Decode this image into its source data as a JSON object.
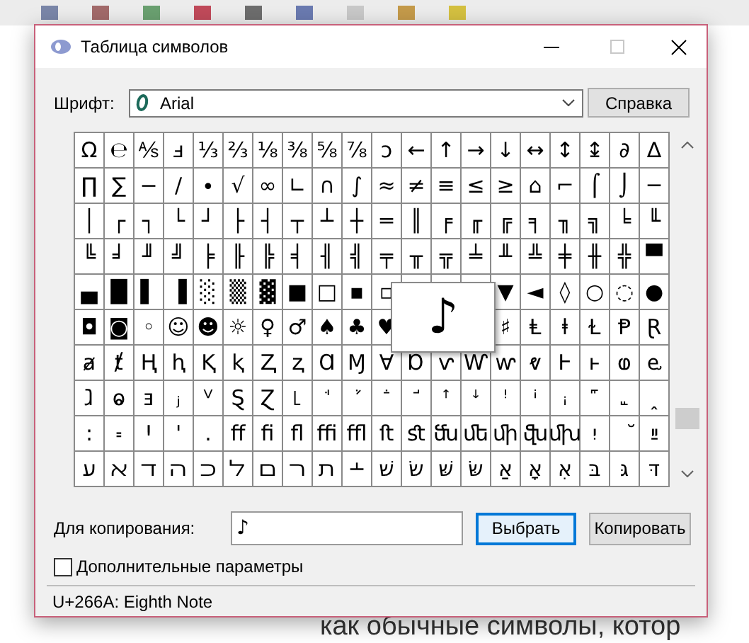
{
  "window": {
    "title": "Таблица символов"
  },
  "font": {
    "label": "Шрифт:",
    "value": "Arial"
  },
  "help_button": "Справка",
  "grid": {
    "rows": [
      [
        "Ω",
        "℮",
        "⅍",
        "ⅎ",
        "⅓",
        "⅔",
        "⅛",
        "⅜",
        "⅝",
        "⅞",
        "ↄ",
        "←",
        "↑",
        "→",
        "↓",
        "↔",
        "↕",
        "↨",
        "∂",
        "∆"
      ],
      [
        "∏",
        "∑",
        "−",
        "∕",
        "∙",
        "√",
        "∞",
        "∟",
        "∩",
        "∫",
        "≈",
        "≠",
        "≡",
        "≤",
        "≥",
        "⌂",
        "⌐",
        "⌠",
        "⌡",
        "─"
      ],
      [
        "│",
        "┌",
        "┐",
        "└",
        "┘",
        "├",
        "┤",
        "┬",
        "┴",
        "┼",
        "═",
        "║",
        "╒",
        "╓",
        "╔",
        "╕",
        "╖",
        "╗",
        "╘",
        "╙"
      ],
      [
        "╚",
        "╛",
        "╜",
        "╝",
        "╞",
        "╟",
        "╠",
        "╡",
        "╢",
        "╣",
        "╤",
        "╥",
        "╦",
        "╧",
        "╨",
        "╩",
        "╪",
        "╫",
        "╬",
        "▀"
      ],
      [
        "▄",
        "█",
        "▌",
        "▐",
        "░",
        "▒",
        "▓",
        "■",
        "□",
        "▪",
        "▫",
        null,
        null,
        null,
        "▼",
        "◄",
        "◊",
        "○",
        "◌",
        "●"
      ],
      [
        "◘",
        "◙",
        "◦",
        "☺",
        "☻",
        "☼",
        "♀",
        "♂",
        "♠",
        "♣",
        "♥",
        null,
        null,
        null,
        "♯",
        "Ⱡ",
        "ⱡ",
        "Ɫ",
        "Ᵽ",
        "Ɽ"
      ],
      [
        "ⱥ",
        "ⱦ",
        "Ⱨ",
        "ⱨ",
        "Ⱪ",
        "ⱪ",
        "Ⱬ",
        "ⱬ",
        "Ɑ",
        "Ɱ",
        "Ɐ",
        "Ɒ",
        "ⱱ",
        "Ⱳ",
        "ⱳ",
        "ⱴ",
        "Ⱶ",
        "ⱶ",
        "ⱷ",
        "ⱸ"
      ],
      [
        "ⱹ",
        "ⱺ",
        "ⱻ",
        "ⱼ",
        "ⱽ",
        "Ȿ",
        "Ɀ",
        "꜖",
        "ꜗ",
        "ꜘ",
        "ꜙ",
        "ꜚ",
        "ꜛ",
        "ꜜ",
        "ꜝ",
        "ꜞ",
        "ꜟ",
        "꜠",
        "꜡",
        "ꞈ"
      ],
      [
        "꞉",
        "꞊",
        "Ꞌ",
        "ꞌ",
        ".",
        "ﬀ",
        "ﬁ",
        "ﬂ",
        "ﬃ",
        "ﬄ",
        "ﬅ",
        "ﬆ",
        "ﬓ",
        "ﬔ",
        "ﬕ",
        "ﬖ",
        "ﬗ",
        "יִ",
        "ﬞ",
        "ײַ"
      ],
      [
        "ﬠ",
        "ﬡ",
        "ﬢ",
        "ﬣ",
        "ﬤ",
        "ﬥ",
        "ﬦ",
        "ﬧ",
        "ﬨ",
        "﬩",
        "שׁ",
        "שׂ",
        "שּׁ",
        "שּׂ",
        "אַ",
        "אָ",
        "אּ",
        "בּ",
        "גּ",
        "דּ"
      ]
    ]
  },
  "preview": "♪",
  "copy": {
    "label": "Для копирования:",
    "value": "♪"
  },
  "buttons": [
    {
      "label": "Выбрать",
      "focused": true
    },
    {
      "label": "Копировать",
      "focused": false
    }
  ],
  "advanced": {
    "label": "Дополнительные параметры",
    "checked": false
  },
  "status_bar": "U+266A: Eighth Note",
  "background_text": "как обычные символы, котор"
}
